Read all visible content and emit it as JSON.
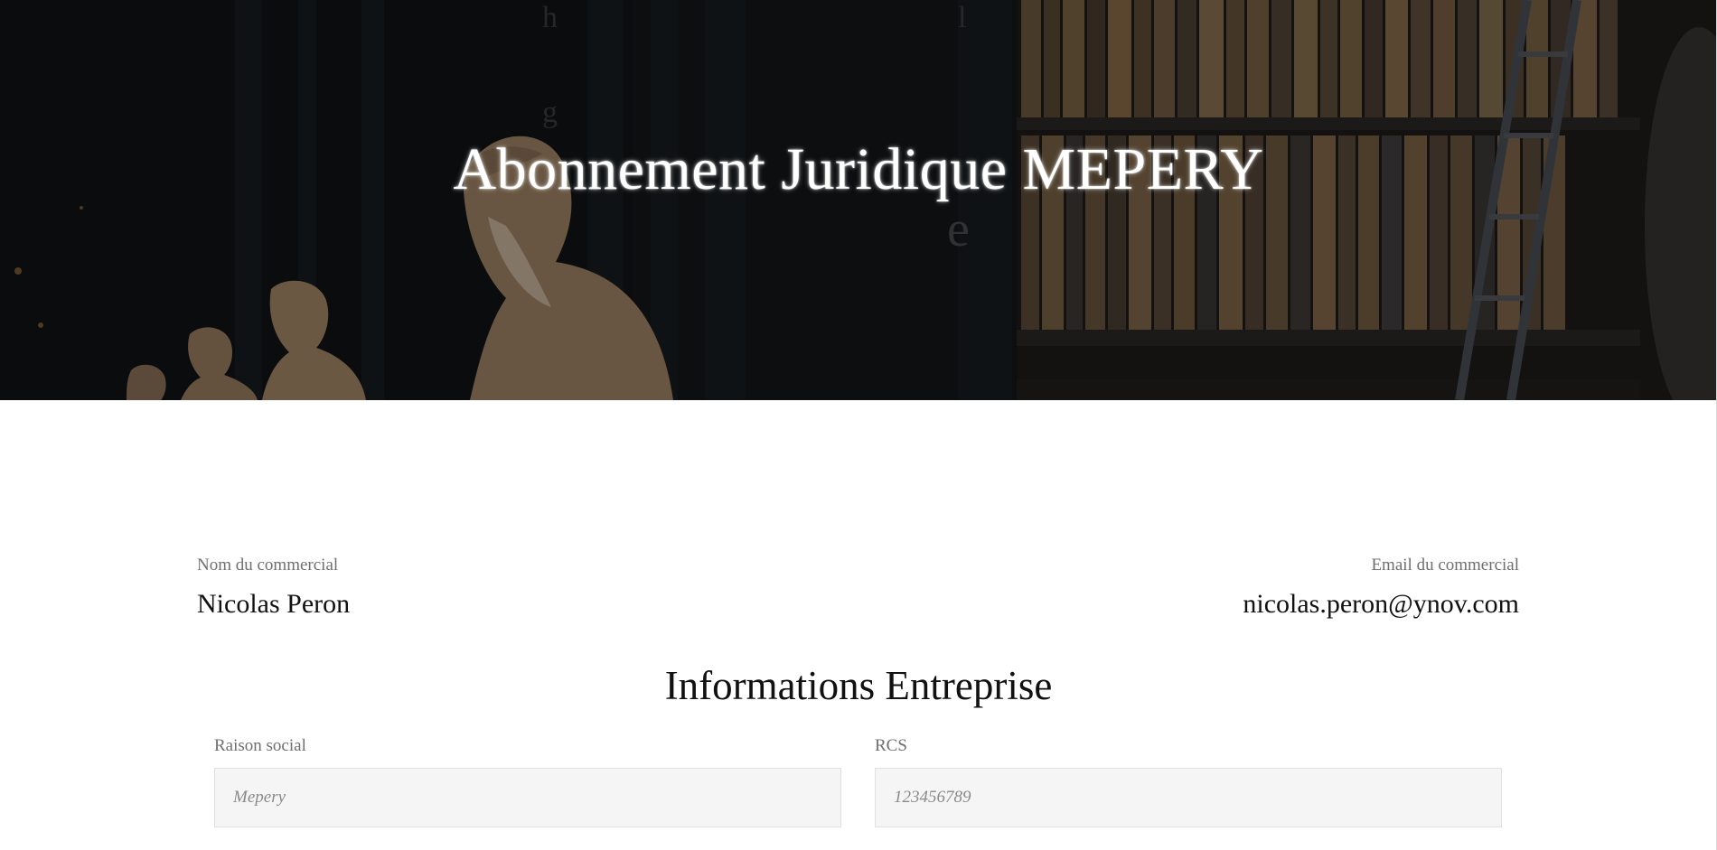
{
  "hero": {
    "title": "Abonnement Juridique MEPERY"
  },
  "commercial": {
    "name_label": "Nom du commercial",
    "name_value": "Nicolas Peron",
    "email_label": "Email du commercial",
    "email_value": "nicolas.peron@ynov.com"
  },
  "company_section": {
    "title": "Informations Entreprise",
    "fields": [
      {
        "label": "Raison social",
        "placeholder": "Mepery",
        "value": ""
      },
      {
        "label": "RCS",
        "placeholder": "123456789",
        "value": ""
      }
    ]
  }
}
